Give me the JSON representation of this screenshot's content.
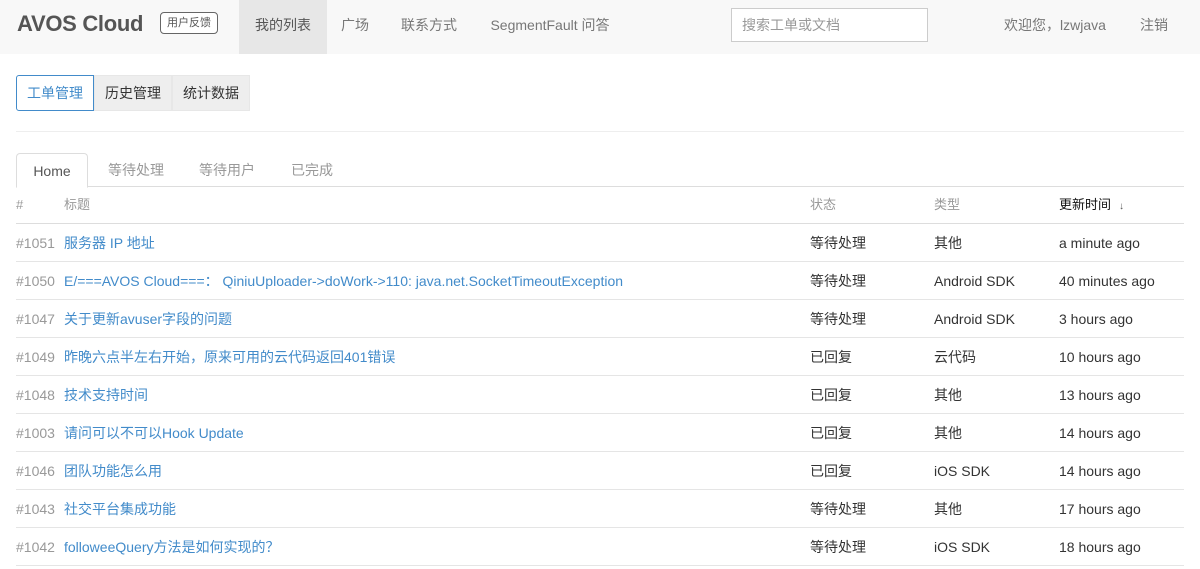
{
  "navbar": {
    "brand": "AVOS Cloud",
    "badge": "用户反馈",
    "items": [
      {
        "label": "我的列表",
        "active": true
      },
      {
        "label": "广场",
        "active": false
      },
      {
        "label": "联系方式",
        "active": false
      },
      {
        "label": "SegmentFault 问答",
        "active": false
      }
    ],
    "search_placeholder": "搜索工单或文档",
    "welcome": "欢迎您，lzwjava",
    "logout": "注销"
  },
  "button_group": [
    {
      "label": "工单管理",
      "active": true
    },
    {
      "label": "历史管理",
      "active": false
    },
    {
      "label": "统计数据",
      "active": false
    }
  ],
  "tabs": [
    {
      "label": "Home",
      "active": true
    },
    {
      "label": "等待处理",
      "active": false
    },
    {
      "label": "等待用户",
      "active": false
    },
    {
      "label": "已完成",
      "active": false
    }
  ],
  "table": {
    "headers": {
      "num": "#",
      "title": "标题",
      "status": "状态",
      "type": "类型",
      "time": "更新时间",
      "sort_arrow": "↓"
    },
    "rows": [
      {
        "num": "#1051",
        "title": "服务器 IP 地址",
        "status": "等待处理",
        "type": "其他",
        "time": "a minute ago"
      },
      {
        "num": "#1050",
        "title": "E/===AVOS Cloud===： QiniuUploader->doWork->110: java.net.SocketTimeoutException",
        "status": "等待处理",
        "type": "Android SDK",
        "time": "40 minutes ago"
      },
      {
        "num": "#1047",
        "title": "关于更新avuser字段的问题",
        "status": "等待处理",
        "type": "Android SDK",
        "time": "3 hours ago"
      },
      {
        "num": "#1049",
        "title": "昨晚六点半左右开始，原来可用的云代码返回401错误",
        "status": "已回复",
        "type": "云代码",
        "time": "10 hours ago"
      },
      {
        "num": "#1048",
        "title": "技术支持时间",
        "status": "已回复",
        "type": "其他",
        "time": "13 hours ago"
      },
      {
        "num": "#1003",
        "title": "请问可以不可以Hook Update",
        "status": "已回复",
        "type": "其他",
        "time": "14 hours ago"
      },
      {
        "num": "#1046",
        "title": "团队功能怎么用",
        "status": "已回复",
        "type": "iOS SDK",
        "time": "14 hours ago"
      },
      {
        "num": "#1043",
        "title": "社交平台集成功能",
        "status": "等待处理",
        "type": "其他",
        "time": "17 hours ago"
      },
      {
        "num": "#1042",
        "title": "followeeQuery方法是如何实现的？",
        "status": "等待处理",
        "type": "iOS SDK",
        "time": "18 hours ago"
      }
    ]
  }
}
